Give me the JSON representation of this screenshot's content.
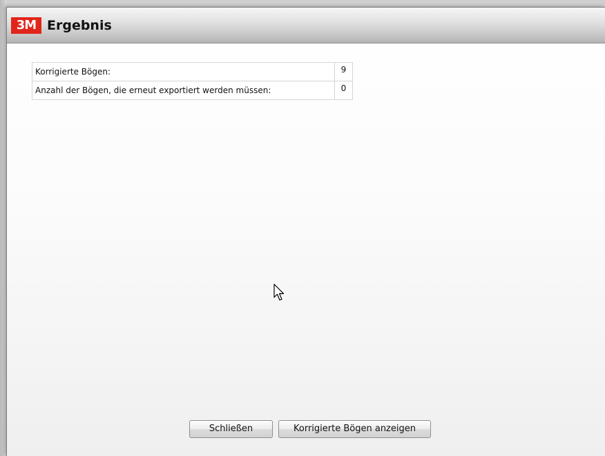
{
  "dialog": {
    "logo_text": "3M",
    "title": "Ergebnis"
  },
  "results": {
    "rows": [
      {
        "label": "Korrigierte Bögen:",
        "value": "9"
      },
      {
        "label": "Anzahl der Bögen, die erneut exportiert werden müssen:",
        "value": "0"
      }
    ]
  },
  "buttons": {
    "close_label": "Schließen",
    "show_label": "Korrigierte Bögen anzeigen"
  },
  "colors": {
    "brand_red": "#e1251b"
  },
  "icons": {
    "cursor": "mouse-pointer-icon"
  }
}
